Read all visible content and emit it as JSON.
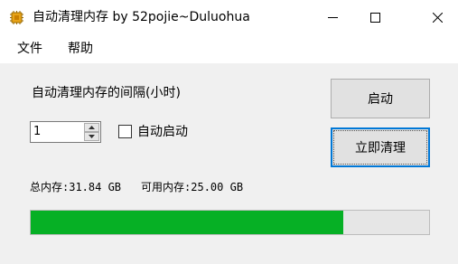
{
  "window": {
    "title": "自动清理内存 by 52pojie~Duluohua",
    "icon": "chip-app-icon"
  },
  "menu": {
    "file": "文件",
    "help": "帮助"
  },
  "settings": {
    "interval_label": "自动清理内存的间隔(小时)",
    "interval_value": "1",
    "auto_start_label": "自动启动",
    "auto_start_checked": false
  },
  "buttons": {
    "start": "启动",
    "clean_now": "立即清理"
  },
  "memory": {
    "total": "总内存:31.84 GB",
    "available": "可用内存:25.00 GB",
    "usage_fraction": 0.785,
    "bar_color": "#06b025"
  }
}
